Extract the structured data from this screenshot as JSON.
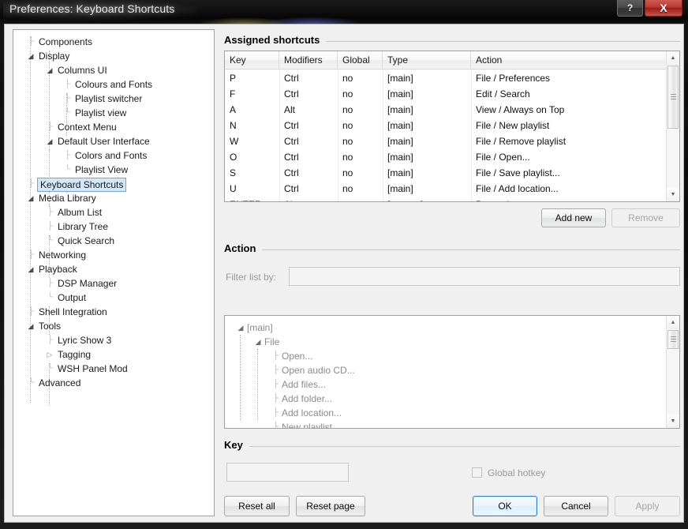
{
  "window": {
    "title": "Preferences: Keyboard Shortcuts",
    "help_label": "?",
    "close_label": "X"
  },
  "sidebar": {
    "items": [
      {
        "label": "Components",
        "depth": 0,
        "state": "leaf"
      },
      {
        "label": "Display",
        "depth": 0,
        "state": "expanded"
      },
      {
        "label": "Columns UI",
        "depth": 1,
        "state": "expanded"
      },
      {
        "label": "Colours and Fonts",
        "depth": 2,
        "state": "leaf"
      },
      {
        "label": "Playlist switcher",
        "depth": 2,
        "state": "leaf"
      },
      {
        "label": "Playlist view",
        "depth": 2,
        "state": "last"
      },
      {
        "label": "Context Menu",
        "depth": 1,
        "state": "leaf"
      },
      {
        "label": "Default User Interface",
        "depth": 1,
        "state": "expanded"
      },
      {
        "label": "Colors and Fonts",
        "depth": 2,
        "state": "leaf"
      },
      {
        "label": "Playlist View",
        "depth": 2,
        "state": "last"
      },
      {
        "label": "Keyboard Shortcuts",
        "depth": 0,
        "state": "leaf",
        "selected": true
      },
      {
        "label": "Media Library",
        "depth": 0,
        "state": "expanded"
      },
      {
        "label": "Album List",
        "depth": 1,
        "state": "leaf"
      },
      {
        "label": "Library Tree",
        "depth": 1,
        "state": "leaf"
      },
      {
        "label": "Quick Search",
        "depth": 1,
        "state": "last"
      },
      {
        "label": "Networking",
        "depth": 0,
        "state": "leaf"
      },
      {
        "label": "Playback",
        "depth": 0,
        "state": "expanded"
      },
      {
        "label": "DSP Manager",
        "depth": 1,
        "state": "leaf"
      },
      {
        "label": "Output",
        "depth": 1,
        "state": "last"
      },
      {
        "label": "Shell Integration",
        "depth": 0,
        "state": "leaf"
      },
      {
        "label": "Tools",
        "depth": 0,
        "state": "expanded"
      },
      {
        "label": "Lyric Show 3",
        "depth": 1,
        "state": "leaf"
      },
      {
        "label": "Tagging",
        "depth": 1,
        "state": "collapsed"
      },
      {
        "label": "WSH Panel Mod",
        "depth": 1,
        "state": "last"
      },
      {
        "label": "Advanced",
        "depth": 0,
        "state": "last"
      }
    ]
  },
  "assigned_shortcuts": {
    "title": "Assigned shortcuts",
    "columns": [
      "Key",
      "Modifiers",
      "Global",
      "Type",
      "Action"
    ],
    "rows": [
      {
        "key": "P",
        "modifiers": "Ctrl",
        "global": "no",
        "type": "[main]",
        "action": "File / Preferences"
      },
      {
        "key": "F",
        "modifiers": "Ctrl",
        "global": "no",
        "type": "[main]",
        "action": "Edit / Search"
      },
      {
        "key": "A",
        "modifiers": "Alt",
        "global": "no",
        "type": "[main]",
        "action": "View / Always on Top"
      },
      {
        "key": "N",
        "modifiers": "Ctrl",
        "global": "no",
        "type": "[main]",
        "action": "File / New playlist"
      },
      {
        "key": "W",
        "modifiers": "Ctrl",
        "global": "no",
        "type": "[main]",
        "action": "File / Remove playlist"
      },
      {
        "key": "O",
        "modifiers": "Ctrl",
        "global": "no",
        "type": "[main]",
        "action": "File / Open..."
      },
      {
        "key": "S",
        "modifiers": "Ctrl",
        "global": "no",
        "type": "[main]",
        "action": "File / Save playlist..."
      },
      {
        "key": "U",
        "modifiers": "Ctrl",
        "global": "no",
        "type": "[main]",
        "action": "File / Add location..."
      },
      {
        "key": "ENTER",
        "modifiers": "Alt",
        "global": "",
        "type": "[context]",
        "action": "Properties"
      }
    ],
    "add_new_label": "Add new",
    "remove_label": "Remove",
    "scroll_up_glyph": "▲",
    "scroll_down_glyph": "▼"
  },
  "action_section": {
    "title": "Action",
    "filter_label": "Filter list by:",
    "filter_value": "",
    "tree": [
      {
        "label": "[main]",
        "depth": 0,
        "state": "expanded"
      },
      {
        "label": "File",
        "depth": 1,
        "state": "expanded"
      },
      {
        "label": "Open...",
        "depth": 2,
        "state": "leaf"
      },
      {
        "label": "Open audio CD...",
        "depth": 2,
        "state": "leaf"
      },
      {
        "label": "Add files...",
        "depth": 2,
        "state": "leaf"
      },
      {
        "label": "Add folder...",
        "depth": 2,
        "state": "leaf"
      },
      {
        "label": "Add location...",
        "depth": 2,
        "state": "leaf"
      },
      {
        "label": "New playlist",
        "depth": 2,
        "state": "leaf"
      }
    ],
    "scroll_up_glyph": "▲",
    "scroll_down_glyph": "▼"
  },
  "key_section": {
    "title": "Key",
    "key_value": "",
    "global_hotkey_label": "Global hotkey",
    "global_hotkey_checked": false
  },
  "footer": {
    "reset_all_label": "Reset all",
    "reset_page_label": "Reset page",
    "ok_label": "OK",
    "cancel_label": "Cancel",
    "apply_label": "Apply"
  },
  "colors": {
    "dialog_bg": "#f0f0f0",
    "selection_fill": "#d4e6f7",
    "selection_border": "#7da2ce",
    "default_button_border": "#2c81c9",
    "close_button": "#b63a31",
    "disabled_text": "#a6a6a6"
  }
}
